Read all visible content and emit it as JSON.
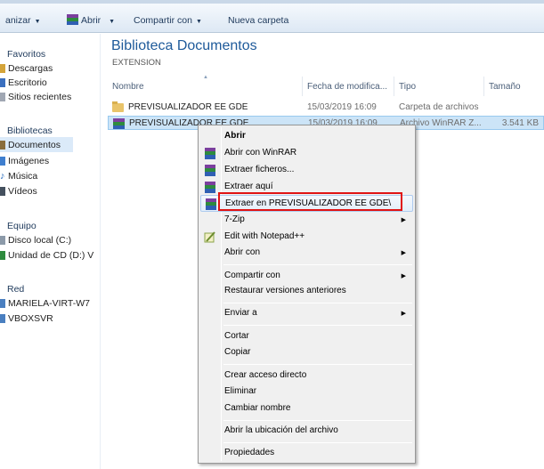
{
  "toolbar": {
    "organize_label": "anizar",
    "open_label": "Abrir",
    "share_label": "Compartir con",
    "new_folder_label": "Nueva carpeta"
  },
  "nav": {
    "favorites_label": "Favoritos",
    "downloads_label": "Descargas",
    "desktop_label": "Escritorio",
    "recent_label": "Sitios recientes",
    "libraries_label": "Bibliotecas",
    "documents_label": "Documentos",
    "images_label": "Imágenes",
    "music_label": "Música",
    "videos_label": "Vídeos",
    "computer_label": "Equipo",
    "local_disk_label": "Disco local (C:)",
    "cd_drive_label": "Unidad de CD (D:) V",
    "network_label": "Red",
    "host1_label": "MARIELA-VIRT-W7",
    "host2_label": "VBOXSVR"
  },
  "library": {
    "title": "Biblioteca Documentos",
    "subtitle": "EXTENSION"
  },
  "columns": {
    "name": "Nombre",
    "modified": "Fecha de modifica...",
    "type": "Tipo",
    "size": "Tamaño"
  },
  "files": [
    {
      "name": "PREVISUALIZADOR EE GDE",
      "modified": "15/03/2019 16:09",
      "type": "Carpeta de archivos",
      "size": ""
    },
    {
      "name": "PREVISUALIZADOR EE GDE",
      "modified": "15/03/2019 16:09",
      "type": "Archivo WinRAR Z...",
      "size": "3.541 KB"
    }
  ],
  "context_menu": {
    "open": "Abrir",
    "open_winrar": "Abrir con WinRAR",
    "extract_files": "Extraer ficheros...",
    "extract_here": "Extraer aquí",
    "extract_to": "Extraer en PREVISUALIZADOR EE GDE\\",
    "seven_zip": "7-Zip",
    "notepad": "Edit with Notepad++",
    "open_with": "Abrir con",
    "share_with": "Compartir con",
    "restore": "Restaurar versiones anteriores",
    "send_to": "Enviar a",
    "cut": "Cortar",
    "copy": "Copiar",
    "shortcut": "Crear acceso directo",
    "delete": "Eliminar",
    "rename": "Cambiar nombre",
    "open_location": "Abrir la ubicación del archivo",
    "properties": "Propiedades"
  },
  "colors": {
    "highlight_border": "#e01414",
    "selection_bg": "#cce4f7",
    "title_blue": "#1e5a9a"
  }
}
